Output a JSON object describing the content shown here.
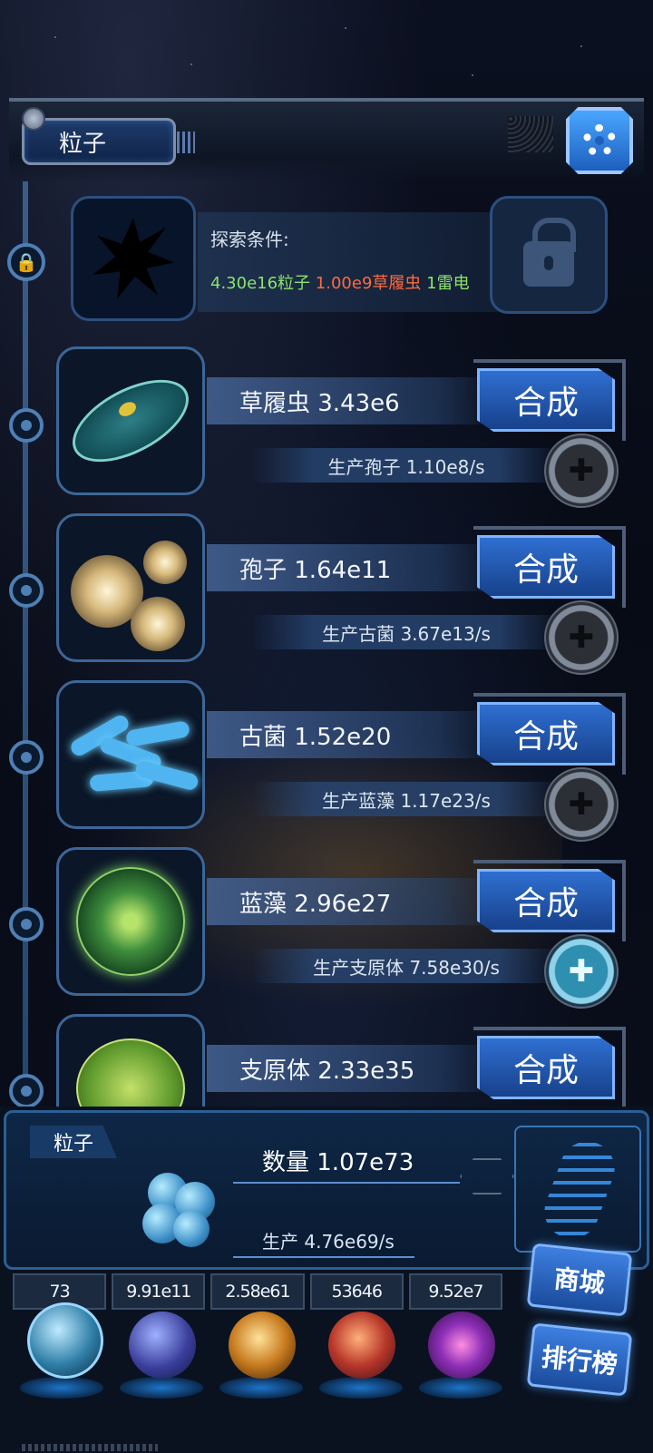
{
  "header": {
    "tab_label": "粒子",
    "settings_icon": "gear-icon"
  },
  "locked_item": {
    "title": "探索条件:",
    "requirements": [
      {
        "text": "4.30e16粒子",
        "color": "#8be36a"
      },
      {
        "text": "1.00e9草履虫",
        "color": "#ff6a3d"
      },
      {
        "text": "1雷电",
        "color": "#8be36a"
      }
    ]
  },
  "rows": [
    {
      "name": "草履虫 3.43e6",
      "craft": "合成",
      "produce": "生产孢子 1.10e8/s",
      "plus_active": false
    },
    {
      "name": "孢子 1.64e11",
      "craft": "合成",
      "produce": "生产古菌 3.67e13/s",
      "plus_active": false
    },
    {
      "name": "古菌 1.52e20",
      "craft": "合成",
      "produce": "生产蓝藻 1.17e23/s",
      "plus_active": false
    },
    {
      "name": "蓝藻 2.96e27",
      "craft": "合成",
      "produce": "生产支原体 7.58e30/s",
      "plus_active": true
    },
    {
      "name": "支原体 2.33e35",
      "craft": "合成"
    }
  ],
  "bottom_panel": {
    "tab": "粒子",
    "quantity": "数量 1.07e73",
    "production": "生产 4.76e69/s"
  },
  "resources": [
    "73",
    "9.91e11",
    "2.58e61",
    "53646",
    "9.52e7"
  ],
  "side_buttons": {
    "shop": "商城",
    "ranking": "排行榜"
  },
  "colors": {
    "accent": "#2f6fd1",
    "green": "#8be36a",
    "orange": "#ff6a3d"
  }
}
